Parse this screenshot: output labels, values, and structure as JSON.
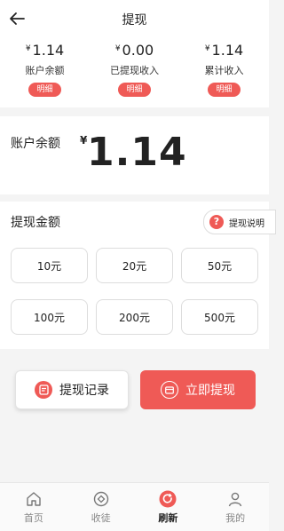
{
  "header": {
    "title": "提现"
  },
  "stats": [
    {
      "currency": "¥",
      "amount": "1.14",
      "label": "账户余额",
      "button": "明细"
    },
    {
      "currency": "¥",
      "amount": "0.00",
      "label": "已提现收入",
      "button": "明细"
    },
    {
      "currency": "¥",
      "amount": "1.14",
      "label": "累计收入",
      "button": "明细"
    }
  ],
  "balance": {
    "label": "账户余额",
    "currency": "¥",
    "amount": "1.14"
  },
  "withdraw": {
    "heading": "提现金额",
    "help": "提现说明",
    "help_icon": "?",
    "options": [
      "10元",
      "20元",
      "50元",
      "100元",
      "200元",
      "500元"
    ]
  },
  "actions": {
    "record": "提现记录",
    "submit": "立即提现"
  },
  "tabs": [
    {
      "label": "首页",
      "icon": "home-icon"
    },
    {
      "label": "收徒",
      "icon": "disciple-icon"
    },
    {
      "label": "刷新",
      "icon": "refresh-icon"
    },
    {
      "label": "我的",
      "icon": "profile-icon"
    }
  ],
  "colors": {
    "accent": "#ef5a56"
  }
}
